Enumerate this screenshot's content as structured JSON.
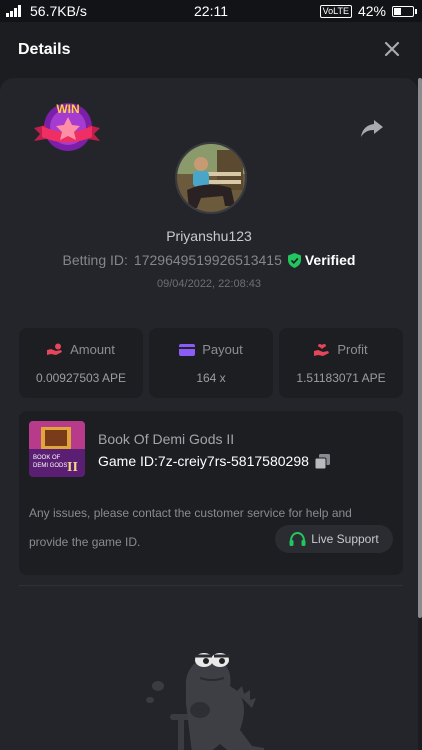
{
  "status_bar": {
    "network_speed": "56.7KB/s",
    "time": "22:11",
    "volte": "VoLTE",
    "battery_text": "42%",
    "battery_level": 0.42
  },
  "header": {
    "title": "Details"
  },
  "bet": {
    "badge_text": "WIN",
    "username": "Priyanshu123",
    "betting_id_label": "Betting ID:",
    "betting_id": "1729649519926513415",
    "verified_label": "Verified",
    "date": "09/04/2022, 22:08:43"
  },
  "stats": [
    {
      "label": "Amount",
      "value": "0.00927503 APE",
      "icon": "hand-coins-icon",
      "color": "#e6455a"
    },
    {
      "label": "Payout",
      "value": "164 x",
      "icon": "wallet-icon",
      "color": "#8b5cf6"
    },
    {
      "label": "Profit",
      "value": "1.51183071 APE",
      "icon": "hand-heart-icon",
      "color": "#e6455a"
    }
  ],
  "game": {
    "name": "Book Of Demi Gods II",
    "thumb_caption_1": "BOOK OF",
    "thumb_caption_2": "DEMI GODS",
    "thumb_caption_3": "II",
    "id_label": "Game ID:",
    "id": "7z-creiy7rs-5817580298",
    "issues_line1": "Any issues, please contact the customer service for help and",
    "issues_line2": "provide the game ID.",
    "live_support": "Live Support"
  },
  "colors": {
    "background": "#1c1d21",
    "panel": "#24252a",
    "card": "#1d1e22",
    "verified_green": "#22c55e",
    "support_green": "#22c55e"
  }
}
